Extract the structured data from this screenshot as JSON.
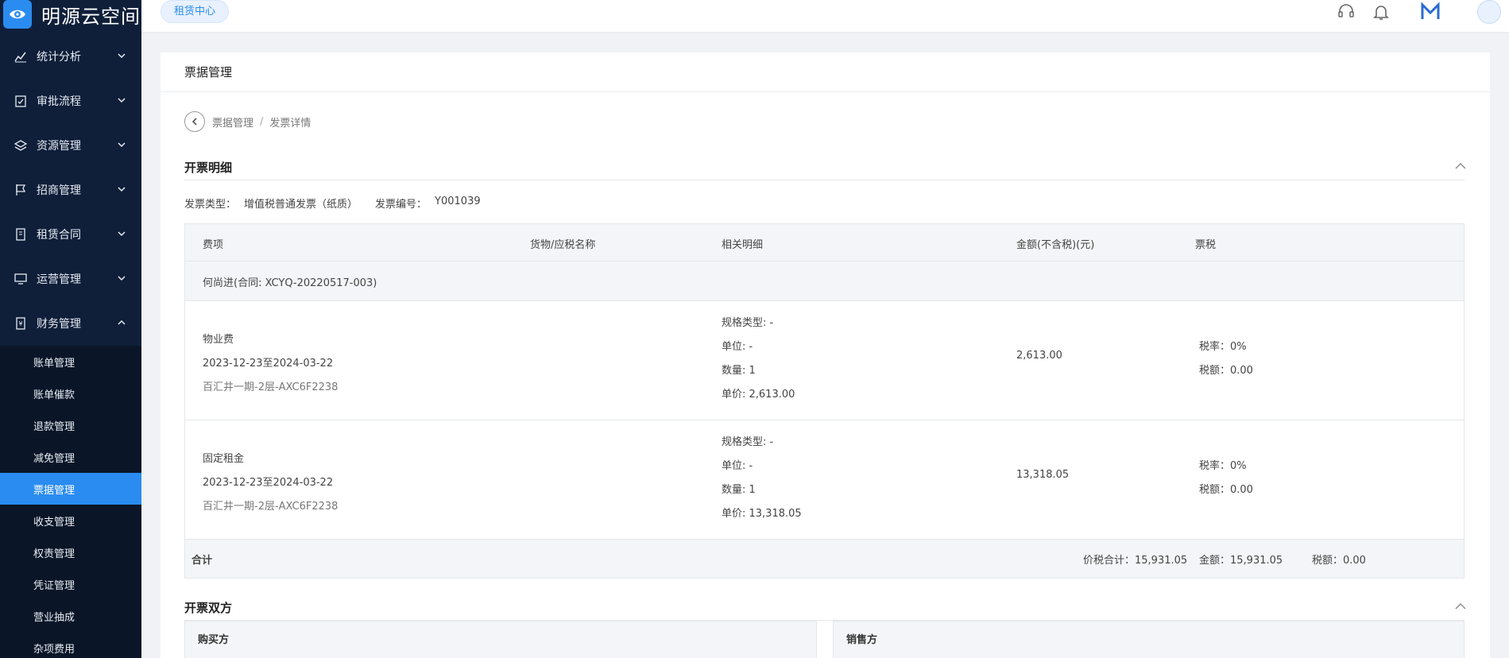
{
  "app": {
    "logo_text": "明源云空间"
  },
  "topbar": {
    "chip_label": "租赁中心"
  },
  "sidebar": {
    "groups": [
      {
        "label": "统计分析",
        "icon": "chart-icon"
      },
      {
        "label": "审批流程",
        "icon": "clipboard-check-icon"
      },
      {
        "label": "资源管理",
        "icon": "layers-icon"
      },
      {
        "label": "招商管理",
        "icon": "flag-icon"
      },
      {
        "label": "租赁合同",
        "icon": "contract-icon"
      },
      {
        "label": "运营管理",
        "icon": "monitor-icon"
      },
      {
        "label": "财务管理",
        "icon": "finance-icon"
      }
    ],
    "finance_items": [
      "账单管理",
      "账单催款",
      "退款管理",
      "减免管理",
      "票据管理",
      "收支管理",
      "权责管理",
      "凭证管理",
      "营业抽成",
      "杂项费用"
    ],
    "active_item": "票据管理"
  },
  "page": {
    "header_title": "票据管理",
    "breadcrumb": {
      "parent": "票据管理",
      "sep": "/",
      "current": "发票详情"
    },
    "section1_title": "开票明细",
    "invoice_type_label": "发票类型：",
    "invoice_type_value": "增值税普通发票（纸质）",
    "invoice_no_label": "发票编号：",
    "invoice_no_value": "Y001039",
    "section2_title": "开票双方",
    "buyer_label": "购买方",
    "seller_label": "销售方"
  },
  "table": {
    "headers": [
      "费项",
      "货物/应税名称",
      "相关明细",
      "金额(不含税)(元)",
      "票税"
    ],
    "group": "何尚进(合同: XCYQ-20220517-003)",
    "rows": [
      {
        "fee": "物业费",
        "period": "2023-12-23至2024-03-22",
        "room": "百汇井一期-2层-AXC6F2238",
        "spec": "规格类型: -",
        "unit": "单位: -",
        "qty": "数量: 1",
        "price": "单价: 2,613.00",
        "amount": "2,613.00",
        "tax_rate": "税率：0%",
        "tax_amount": "税额：0.00"
      },
      {
        "fee": "固定租金",
        "period": "2023-12-23至2024-03-22",
        "room": "百汇井一期-2层-AXC6F2238",
        "spec": "规格类型: -",
        "unit": "单位: -",
        "qty": "数量: 1",
        "price": "单价: 13,318.05",
        "amount": "13,318.05",
        "tax_rate": "税率：0%",
        "tax_amount": "税额：0.00"
      }
    ],
    "summary": {
      "label": "合计",
      "total_with_tax": "价税合计：15,931.05",
      "amount": "金额：15,931.05",
      "tax": "税额：0.00"
    }
  }
}
